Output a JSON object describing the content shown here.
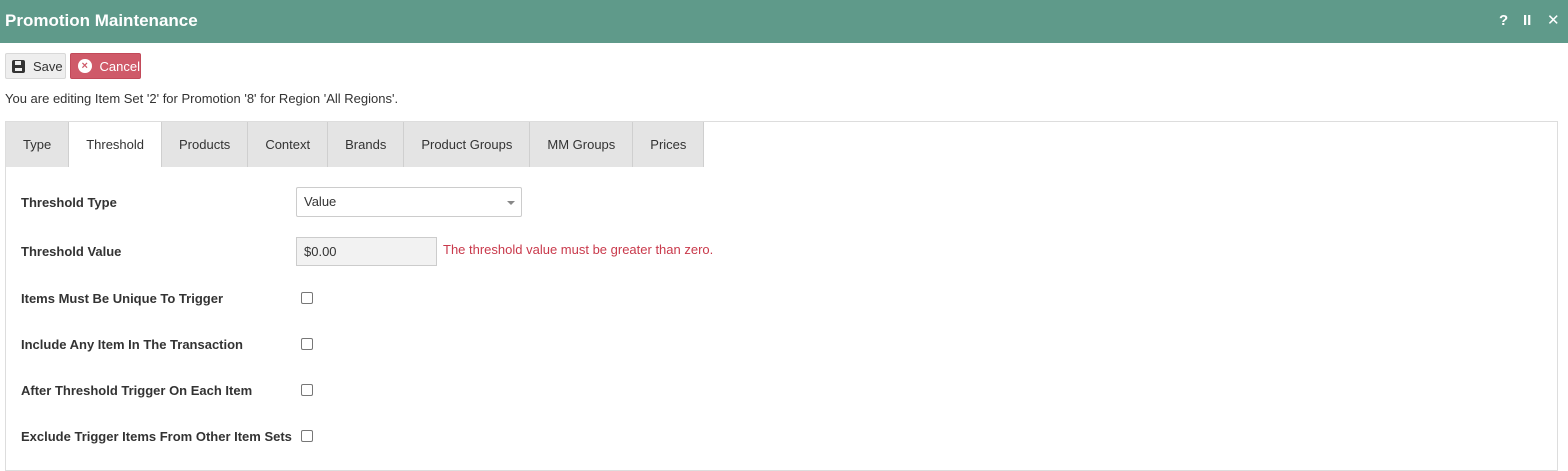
{
  "window": {
    "title": "Promotion Maintenance",
    "controls": {
      "help": "?",
      "pause": "II",
      "close": "✕"
    }
  },
  "toolbar": {
    "save_label": "Save",
    "cancel_label": "Cancel"
  },
  "edit_info": "You are editing Item Set '2' for Promotion '8' for Region 'All Regions'.",
  "tabs": [
    {
      "label": "Type"
    },
    {
      "label": "Threshold",
      "active": true
    },
    {
      "label": "Products"
    },
    {
      "label": "Context"
    },
    {
      "label": "Brands"
    },
    {
      "label": "Product Groups"
    },
    {
      "label": "MM Groups"
    },
    {
      "label": "Prices"
    }
  ],
  "form": {
    "threshold_type": {
      "label": "Threshold Type",
      "value": "Value"
    },
    "threshold_value": {
      "label": "Threshold Value",
      "value": "$0.00",
      "error": "The threshold value must be greater than zero."
    },
    "items_unique": {
      "label": "Items Must Be Unique To Trigger",
      "checked": false
    },
    "include_any": {
      "label": "Include Any Item In The Transaction",
      "checked": false
    },
    "after_threshold": {
      "label": "After Threshold Trigger On Each Item",
      "checked": false
    },
    "exclude_trigger": {
      "label": "Exclude Trigger Items From Other Item Sets",
      "checked": false
    }
  },
  "colors": {
    "titlebar": "#5f9a8a",
    "cancel": "#cf5a69",
    "error": "#c9394b"
  }
}
